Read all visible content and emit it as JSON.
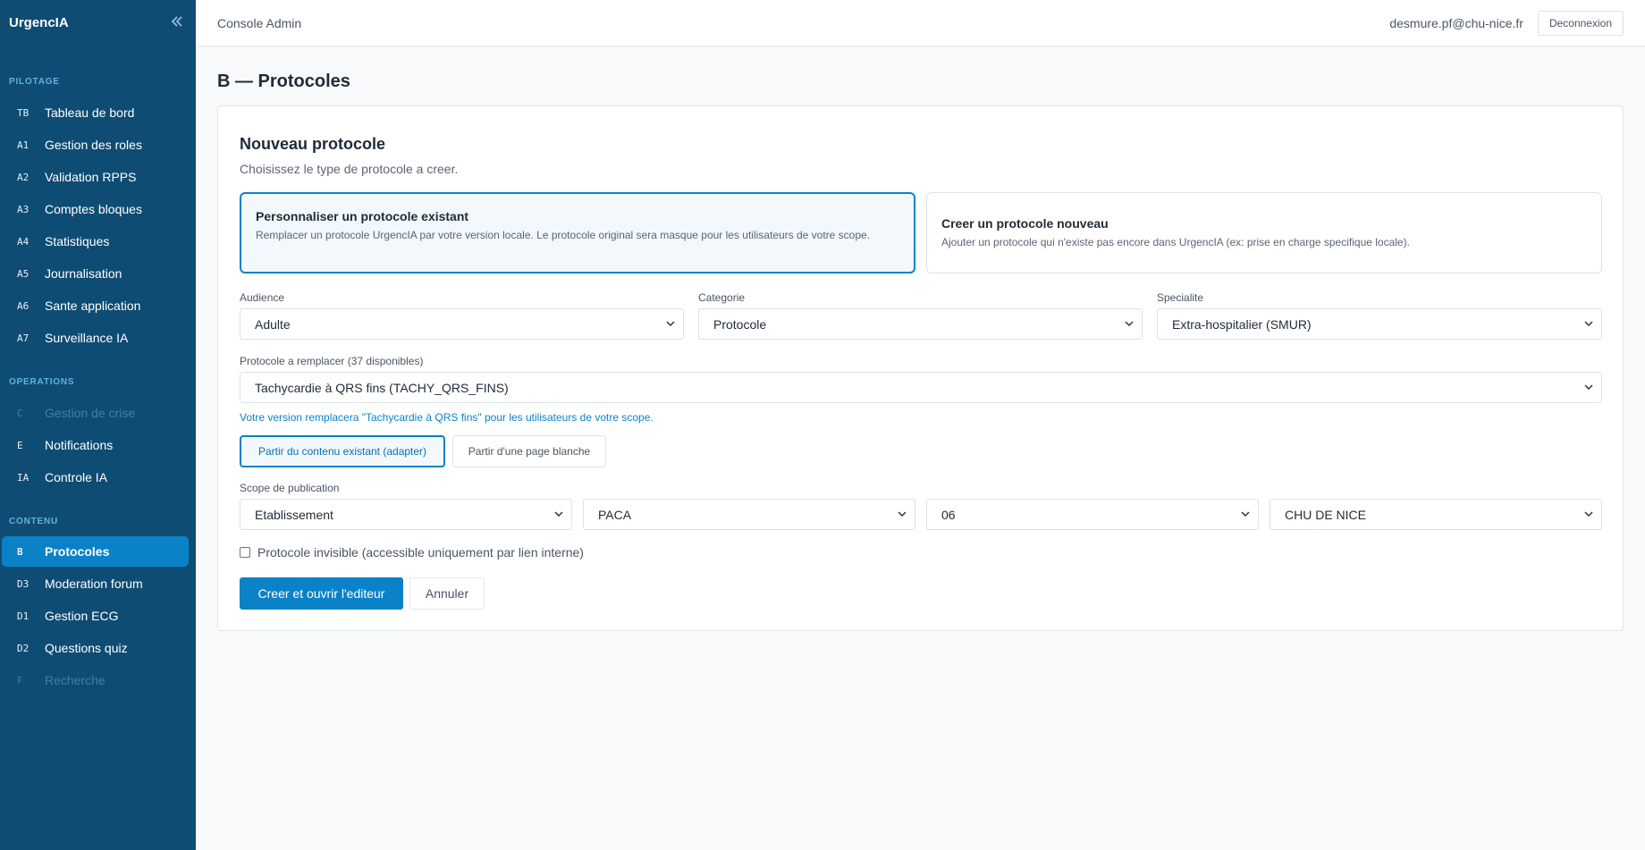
{
  "sidebar": {
    "brand": "UrgencIA",
    "sections": {
      "pilotage": "PILOTAGE",
      "operations": "OPERATIONS",
      "contenu": "CONTENU"
    },
    "items": [
      {
        "code": "TB",
        "label": "Tableau de bord"
      },
      {
        "code": "A1",
        "label": "Gestion des roles"
      },
      {
        "code": "A2",
        "label": "Validation RPPS"
      },
      {
        "code": "A3",
        "label": "Comptes bloques"
      },
      {
        "code": "A4",
        "label": "Statistiques"
      },
      {
        "code": "A5",
        "label": "Journalisation"
      },
      {
        "code": "A6",
        "label": "Sante application"
      },
      {
        "code": "A7",
        "label": "Surveillance IA"
      },
      {
        "code": "C",
        "label": "Gestion de crise",
        "disabled": true
      },
      {
        "code": "E",
        "label": "Notifications"
      },
      {
        "code": "IA",
        "label": "Controle IA"
      },
      {
        "code": "B",
        "label": "Protocoles",
        "active": true
      },
      {
        "code": "D3",
        "label": "Moderation forum"
      },
      {
        "code": "D1",
        "label": "Gestion ECG"
      },
      {
        "code": "D2",
        "label": "Questions quiz"
      },
      {
        "code": "F",
        "label": "Recherche",
        "disabled": true
      }
    ]
  },
  "header": {
    "console": "Console Admin",
    "email": "desmure.pf@chu-nice.fr",
    "logout": "Deconnexion"
  },
  "page": {
    "title": "B — Protocoles"
  },
  "form": {
    "title": "Nouveau protocole",
    "subtitle": "Choisissez le type de protocole a creer.",
    "option_existing": {
      "title": "Personnaliser un protocole existant",
      "desc": "Remplacer un protocole UrgencIA par votre version locale. Le protocole original sera masque pour les utilisateurs de votre scope."
    },
    "option_new": {
      "title": "Creer un protocole nouveau",
      "desc": "Ajouter un protocole qui n'existe pas encore dans UrgencIA (ex: prise en charge specifique locale)."
    },
    "audience": {
      "label": "Audience",
      "value": "Adulte"
    },
    "categorie": {
      "label": "Categorie",
      "value": "Protocole"
    },
    "specialite": {
      "label": "Specialite",
      "value": "Extra-hospitalier (SMUR)"
    },
    "protocole": {
      "label": "Protocole a remplacer (37 disponibles)",
      "value": "Tachycardie à QRS fins (TACHY_QRS_FINS)"
    },
    "hint": "Votre version remplacera \"Tachycardie à QRS fins\" pour les utilisateurs de votre scope.",
    "mode_adapt": "Partir du contenu existant (adapter)",
    "mode_blank": "Partir d'une page blanche",
    "scope": {
      "label": "Scope de publication",
      "level": "Etablissement",
      "region": "PACA",
      "departement": "06",
      "etablissement": "CHU DE NICE"
    },
    "invisible_label": "Protocole invisible (accessible uniquement par lien interne)",
    "submit": "Creer et ouvrir l'editeur",
    "cancel": "Annuler"
  }
}
